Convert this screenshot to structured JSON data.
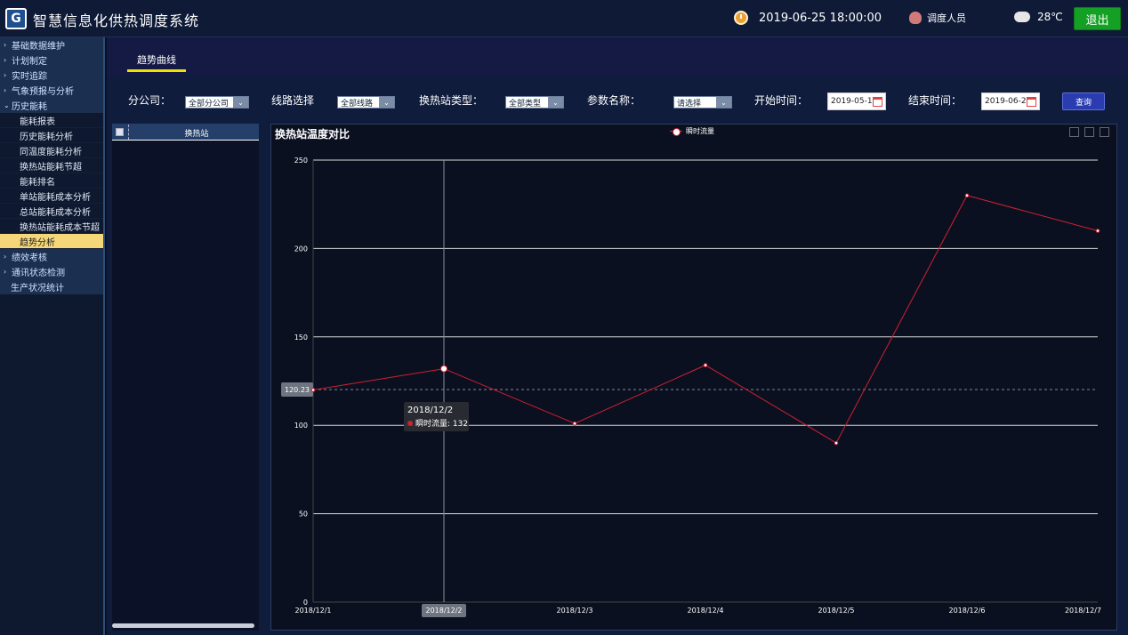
{
  "app": {
    "title": "智慧信息化供热调度系统",
    "logo_letter": "G"
  },
  "topbar": {
    "datetime": "2019-06-25 18:00:00",
    "user_role": "调度人员",
    "temperature": "28℃",
    "logout_label": "退出"
  },
  "sidebar": {
    "items": [
      {
        "label": "基础数据维护",
        "caret": "›"
      },
      {
        "label": "计划制定",
        "caret": "›"
      },
      {
        "label": "实时追踪",
        "caret": "›"
      },
      {
        "label": "气象预报与分析",
        "caret": "›"
      },
      {
        "label": "历史能耗",
        "caret": "⌄"
      }
    ],
    "subitems": [
      {
        "label": "能耗报表"
      },
      {
        "label": "历史能耗分析"
      },
      {
        "label": "同温度能耗分析"
      },
      {
        "label": "换热站能耗节超"
      },
      {
        "label": "能耗排名"
      },
      {
        "label": "单站能耗成本分析"
      },
      {
        "label": "总站能耗成本分析"
      },
      {
        "label": "换热站能耗成本节超"
      },
      {
        "label": "趋势分析"
      }
    ],
    "bottom_items": [
      {
        "label": "绩效考核",
        "caret": "›"
      },
      {
        "label": "通讯状态检测",
        "caret": "›"
      },
      {
        "label": "生产状况统计",
        "caret": ""
      }
    ]
  },
  "tabs": {
    "active": "趋势曲线"
  },
  "filters": {
    "company_label": "分公司：",
    "company_value": "全部分公司",
    "line_label": "线路选择",
    "line_value": "全部线路",
    "type_label": "换热站类型：",
    "type_value": "全部类型",
    "param_label": "参数名称：",
    "param_value": "请选择",
    "start_label": "开始时间：",
    "start_value": "2019-05-1",
    "end_label": "结束时间：",
    "end_value": "2019-06-2",
    "query_label": "查询"
  },
  "station_table": {
    "header": "换热站"
  },
  "chart_data": {
    "type": "line",
    "title": "换热站温度对比",
    "categories": [
      "2018/12/1",
      "2018/12/2",
      "2018/12/3",
      "2018/12/4",
      "2018/12/5",
      "2018/12/6",
      "2018/12/7"
    ],
    "series": [
      {
        "name": "瞬时流量",
        "values": [
          120,
          132,
          101,
          134,
          90,
          230,
          210
        ],
        "color": "#d02030"
      }
    ],
    "ylim": [
      0,
      250
    ],
    "yticks": [
      0,
      50,
      100,
      150,
      200,
      250
    ],
    "grid": true,
    "legend": "top-center",
    "crosshair": {
      "category_index": 1,
      "y_readout": "120.23",
      "y_value": 120.23
    },
    "tooltip": {
      "title": "2018/12/2",
      "series_name": "瞬时流量",
      "value": "132"
    }
  }
}
